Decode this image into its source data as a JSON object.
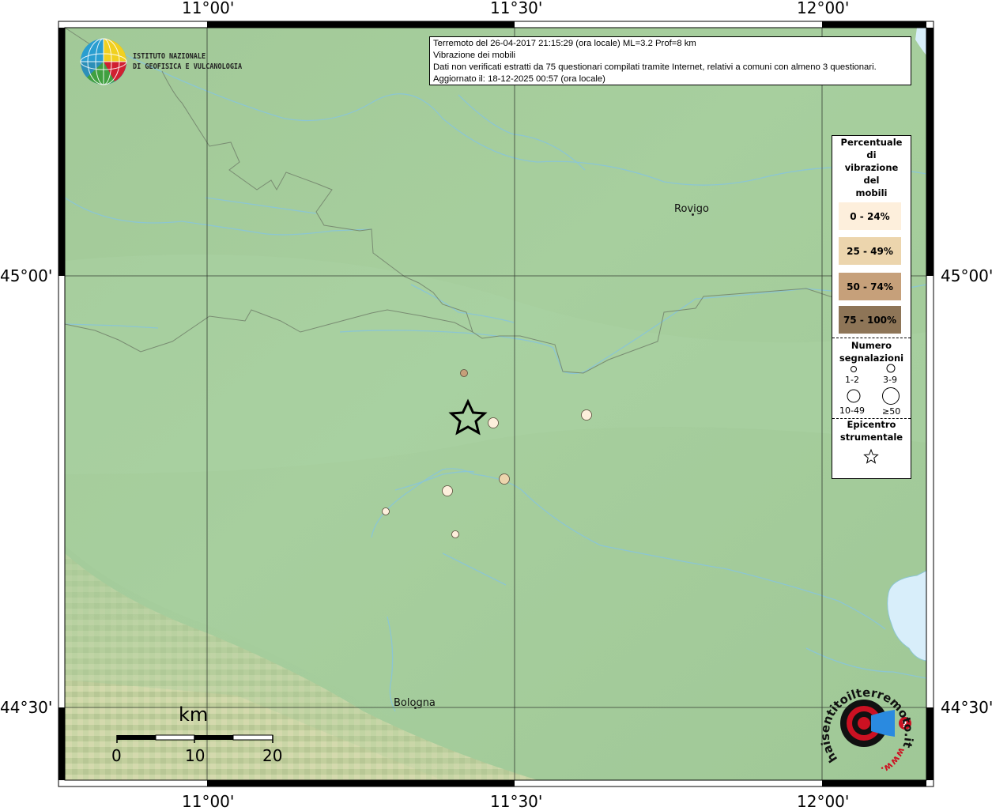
{
  "map": {
    "frame_ticks": {
      "top": [
        "11°00'",
        "11°30'",
        "12°00'"
      ],
      "bottom": [
        "11°00'",
        "11°30'",
        "12°00'"
      ],
      "left": [
        "45°00'",
        "44°30'"
      ],
      "right": [
        "45°00'",
        "44°30'"
      ]
    },
    "cities": [
      "Rovigo",
      "Bologna"
    ],
    "colors": {
      "plain": "#a3cb99",
      "plain_light": "#abd2a3",
      "hills": "#c9d3a4",
      "river": "#8cc6d2",
      "border": "#7a8d74",
      "sea": "#d8eefa",
      "star": "#000000"
    }
  },
  "institute_logo": {
    "line1": "ISTITUTO NAZIONALE",
    "line2": "DI GEOFISICA E VULCANOLOGIA"
  },
  "info": {
    "line1": "Terremoto del 26-04-2017 21:15:29 (ora locale) ML=3.2 Prof=8 km",
    "line2": "Vibrazione dei mobili",
    "line3": "Dati non verificati estratti da 75 questionari compilati tramite Internet, relativi a comuni con almeno 3 questionari.",
    "line4": "Aggiornato il: 18-12-2025 00:57 (ora locale)"
  },
  "legend": {
    "title_lines": [
      "Percentuale",
      "di",
      "vibrazione",
      "del",
      "mobili"
    ],
    "bins": [
      {
        "label": "0 - 24%",
        "color": "#fdefdc"
      },
      {
        "label": "25 - 49%",
        "color": "#ecd5ad"
      },
      {
        "label": "50 - 74%",
        "color": "#c6a07a"
      },
      {
        "label": "75 - 100%",
        "color": "#8e7557"
      }
    ],
    "count_title_lines": [
      "Numero",
      "segnalazioni"
    ],
    "count_sizes": [
      "1-2",
      "3-9",
      "10-49",
      "≥50"
    ],
    "epicenter_title_lines": [
      "Epicentro",
      "strumentale"
    ]
  },
  "observations": [
    {
      "pct_bin": 2,
      "count_size": "1-2"
    },
    {
      "pct_bin": 0,
      "count_size": "3-9"
    },
    {
      "pct_bin": 0,
      "count_size": "3-9"
    },
    {
      "pct_bin": 1,
      "count_size": "3-9"
    },
    {
      "pct_bin": 0,
      "count_size": "3-9"
    },
    {
      "pct_bin": 0,
      "count_size": "1-2"
    },
    {
      "pct_bin": 0,
      "count_size": "1-2"
    }
  ],
  "scale_bar": {
    "unit": "km",
    "labels": [
      "0",
      "10",
      "20"
    ]
  },
  "hsit_logo": {
    "text_ring": "haisentitoilterremoto.it",
    "url": "www."
  }
}
